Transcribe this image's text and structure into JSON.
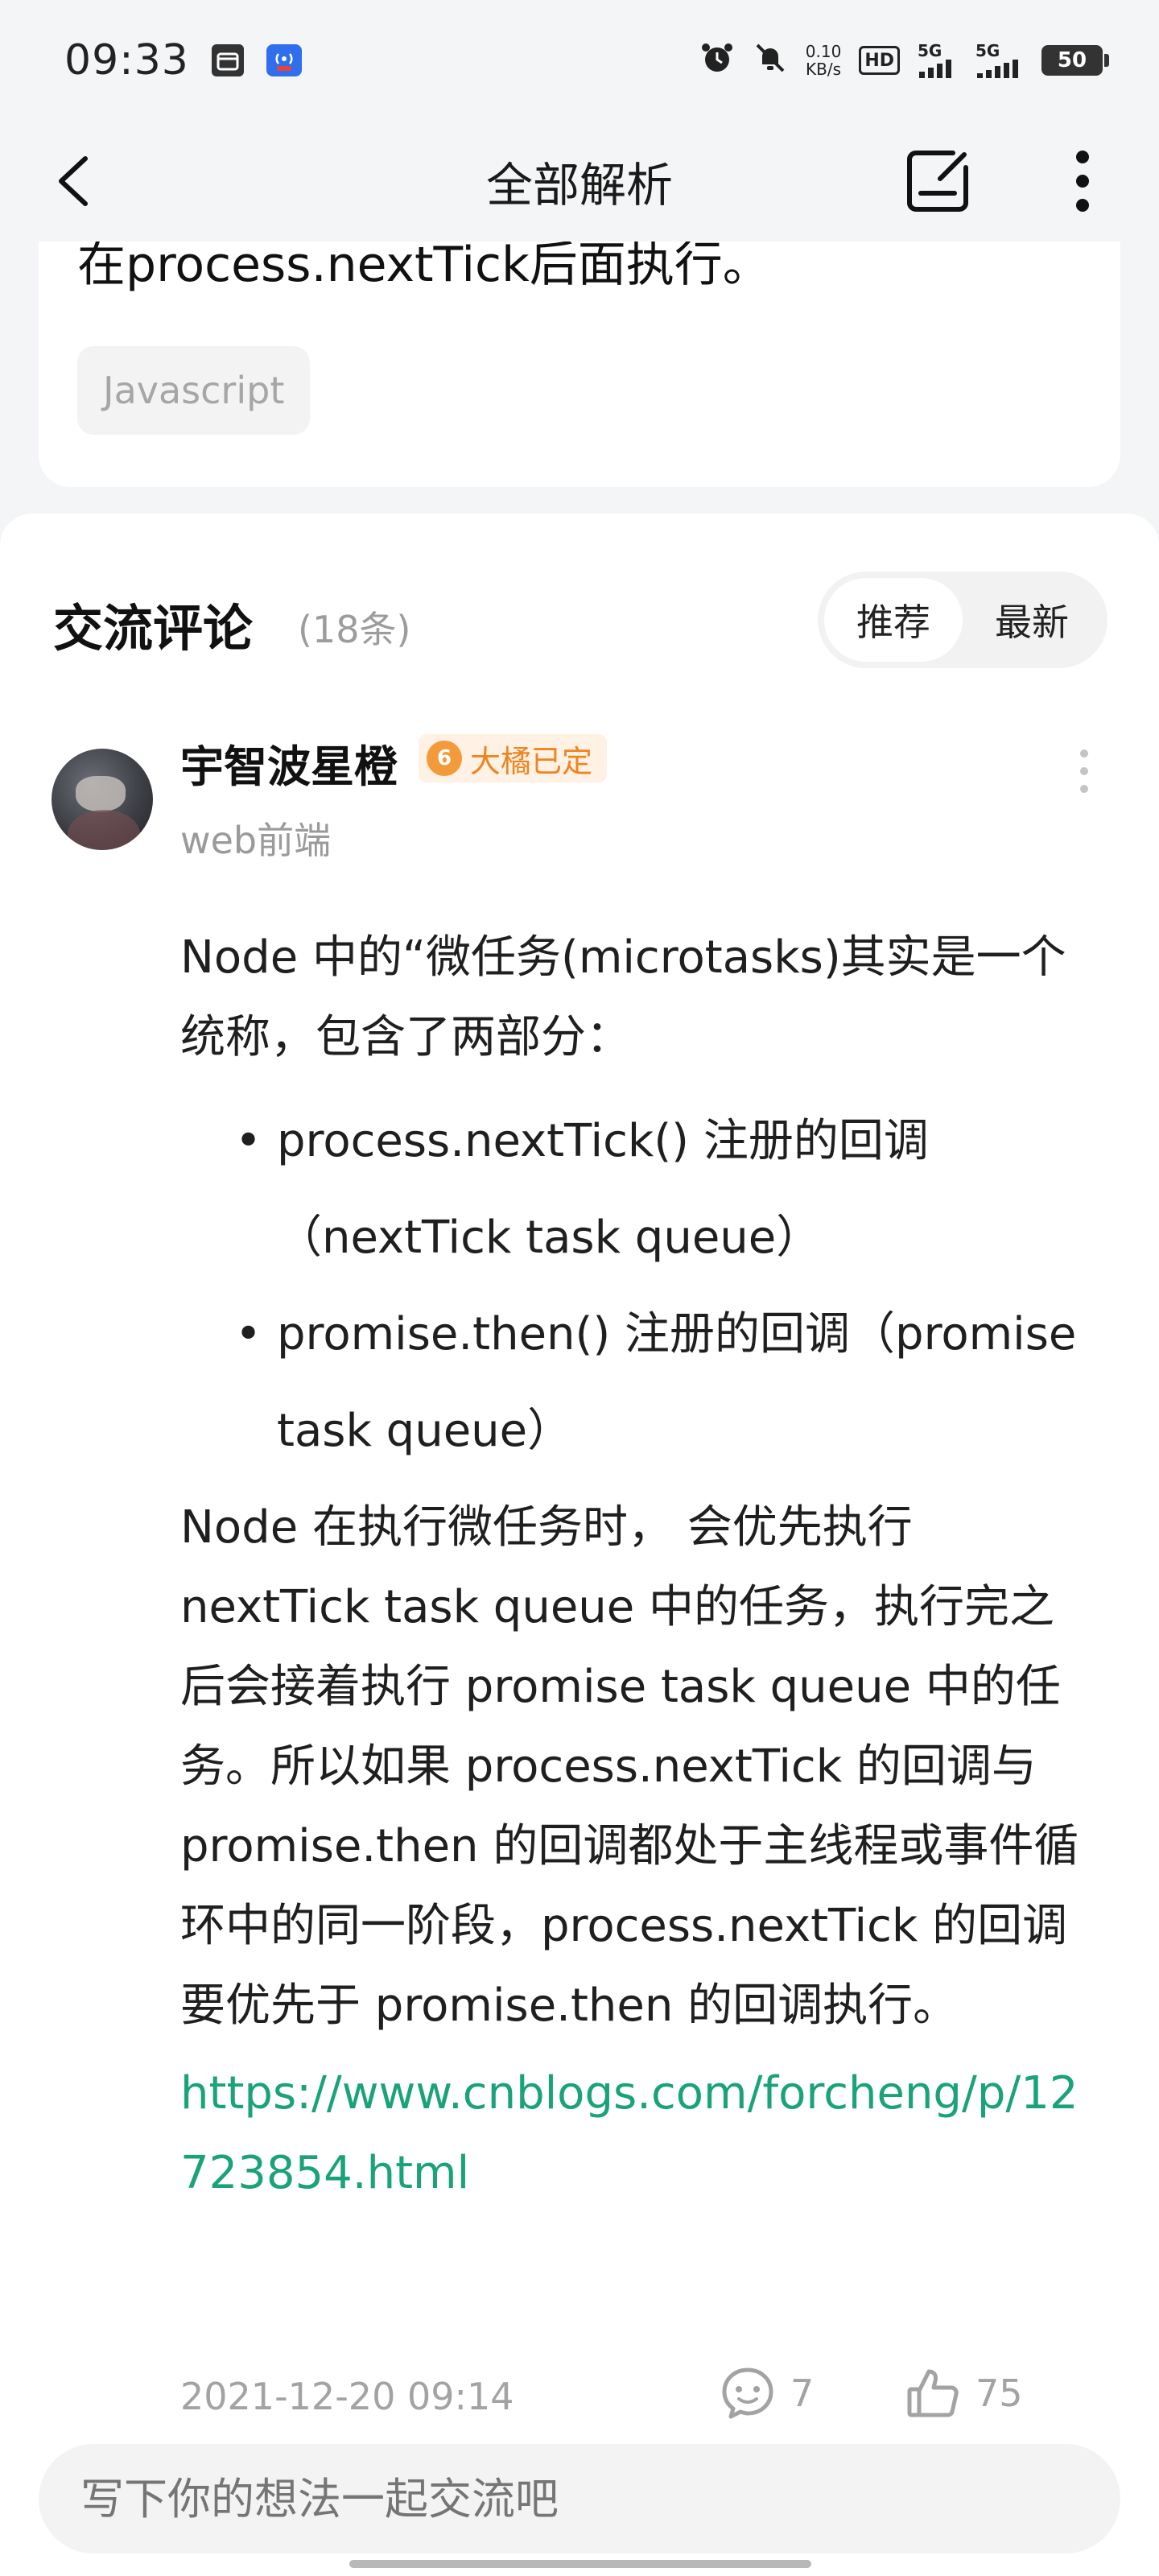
{
  "status_bar": {
    "time": "09:33",
    "net_speed_value": "0.10",
    "net_speed_unit": "KB/s",
    "hd_label": "HD",
    "sim1_label": "5G",
    "sim2_label": "5G",
    "battery": "50",
    "app_badge": "5G"
  },
  "nav": {
    "title": "全部解析"
  },
  "top_card": {
    "text": "在process.nextTick后面执行。",
    "tag": "Javascript"
  },
  "comments": {
    "title": "交流评论",
    "count": "(18条)",
    "sort_options": [
      "推荐",
      "最新"
    ],
    "active_sort": "推荐"
  },
  "comment": {
    "user_name": "宇智波星橙",
    "level": "6",
    "badge": "大橘已定",
    "role": "web前端",
    "intro": "Node 中的“微任务(microtasks)其实是一个统称，包含了两部分：",
    "bullets": [
      "process.nextTick() 注册的回调（nextTick task queue）",
      "promise.then() 注册的回调（promise task queue）"
    ],
    "body": "Node 在执行微任务时， 会优先执行 nextTick task queue 中的任务，执行完之后会接着执行 promise task queue 中的任务。所以如果 process.nextTick 的回调与 promise.then 的回调都处于主线程或事件循环中的同一阶段，process.nextTick 的回调要优先于 promise.then 的回调执行。",
    "link": "https://www.cnblogs.com/forcheng/p/12723854.html",
    "time": "2021-12-20 09:14",
    "reply_count": "7",
    "like_count": "75"
  },
  "input": {
    "placeholder": "写下你的想法一起交流吧"
  },
  "colors": {
    "link": "#1aa37a",
    "badge": "#ee8422",
    "muted": "#9c9c9c"
  }
}
